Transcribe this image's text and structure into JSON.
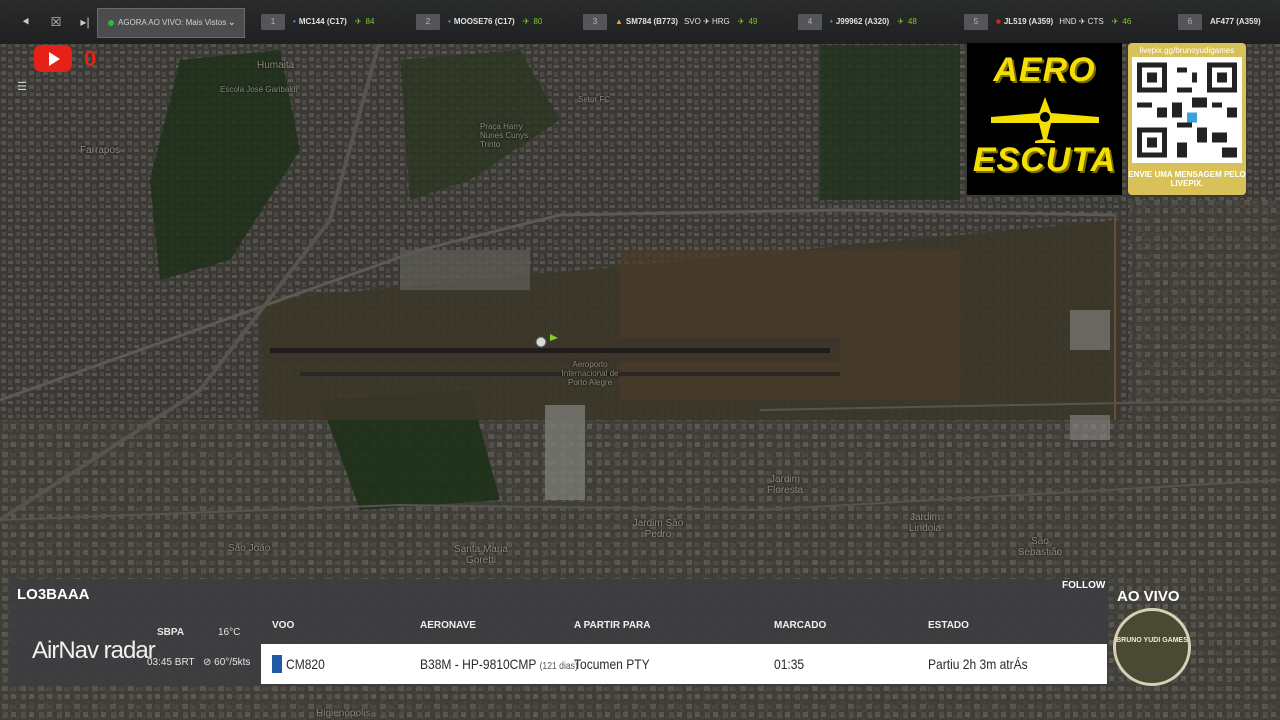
{
  "topbar": {
    "live_select_label": "AGORA AO VIVO: Mais Vistos",
    "flights": [
      {
        "num": "1",
        "flight": "MC144 (C17)",
        "route": "",
        "alt": "84"
      },
      {
        "num": "2",
        "flight": "MOOSE76 (C17)",
        "route": "",
        "alt": "80"
      },
      {
        "num": "3",
        "flight": "SM784 (B773)",
        "route": "SVO ✈ HRG",
        "alt": "49"
      },
      {
        "num": "4",
        "flight": "J99962 (A320)",
        "route": "",
        "alt": "48"
      },
      {
        "num": "5",
        "flight": "JL519 (A359)",
        "route": "HND ✈ CTS",
        "alt": "46"
      },
      {
        "num": "6",
        "flight": "AF477 (A359)",
        "route": "",
        "alt": ""
      }
    ]
  },
  "youtube": {
    "count": "0"
  },
  "map_labels": {
    "humaita": "Humaitá",
    "farrapos": "Farrapos",
    "escola": "Escola José Garibaldi",
    "setor": "Setor FC",
    "praca": "Praça Harry Nunes Cunys Trinto",
    "aeroporto": "Aeroporto Internacional de Porto Alegre",
    "jardim_floresta": "Jardim Floresta",
    "jardim_sao_pedro": "Jardim São Pedro",
    "jardim_lindoia": "Jardim Lindoia",
    "santa_maria": "Santa Maria Goretti",
    "sao_joao": "São João",
    "sao_sebastiao": "São Sebastião",
    "higienopolis": "Higienópolis"
  },
  "aero_escuta": {
    "line1": "AERO",
    "line2": "ESCUTA"
  },
  "livepix": {
    "url": "livepix.gg/brunoyudigames",
    "message": "ENVIE UMA MENSAGEM PELO LIVEPIX."
  },
  "panel": {
    "registration": "LO3BAAA",
    "follow": "FOLLOW",
    "ao_vivo": "AO VIVO",
    "brand": "AirNav radar",
    "airport": "SBPA",
    "time": "03:45 BRT",
    "temp": "16°C",
    "wind": "60°/5kts",
    "headers": {
      "voo": "VOO",
      "aeronave": "AERONAVE",
      "destino": "A PARTIR PARA",
      "marcado": "MARCADO",
      "estado": "ESTADO"
    },
    "row": {
      "voo": "CM820",
      "aeronave": "B38M - HP-9810CMP",
      "aeronave_age": "(121 dias)",
      "destino": "Tocumen PTY",
      "marcado": "01:35",
      "estado": "Partiu 2h 3m atrÁs"
    }
  },
  "badge": {
    "text": "BRUNO YUDI GAMES"
  }
}
